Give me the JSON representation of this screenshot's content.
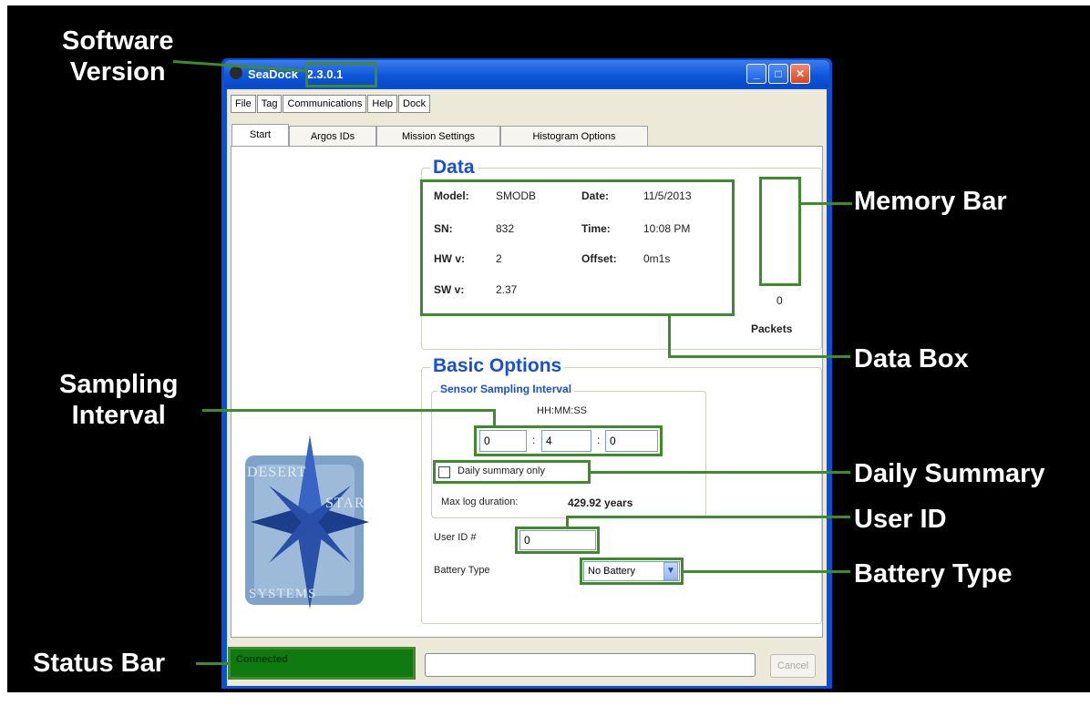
{
  "callouts": {
    "software_version_line1": "Software",
    "software_version_line2": "Version",
    "memory_bar": "Memory Bar",
    "data_box": "Data Box",
    "sampling_line1": "Sampling",
    "sampling_line2": "Interval",
    "daily_summary": "Daily Summary",
    "user_id": "User ID",
    "battery_type": "Battery Type",
    "status_bar": "Status Bar"
  },
  "window": {
    "app_name": "SeaDock",
    "version": "2.3.0.1"
  },
  "menu": [
    "File",
    "Tag",
    "Communications",
    "Help",
    "Dock"
  ],
  "tabs": [
    "Start",
    "Argos IDs",
    "Mission Settings",
    "Histogram Options"
  ],
  "data_group": {
    "title": "Data",
    "model_label": "Model:",
    "model_value": "SMODB",
    "date_label": "Date:",
    "date_value": "11/5/2013",
    "sn_label": "SN:",
    "sn_value": "832",
    "time_label": "Time:",
    "time_value": "10:08 PM",
    "hw_label": "HW v:",
    "hw_value": "2",
    "offset_label": "Offset:",
    "offset_value": "0m1s",
    "sw_label": "SW v:",
    "sw_value": "2.37",
    "packets_count": "0",
    "packets_label": "Packets"
  },
  "basic_options": {
    "title": "Basic Options",
    "sensor_title": "Sensor Sampling Interval",
    "format_label": "HH:MM:SS",
    "hh": "0",
    "mm": "4",
    "ss": "0",
    "colon": ":",
    "daily_summary_label": "Daily summary only",
    "max_log_label": "Max log duration:",
    "max_log_value": "429.92 years",
    "user_id_label": "User ID #",
    "user_id_value": "0",
    "battery_label": "Battery Type",
    "battery_value": "No Battery"
  },
  "logo": {
    "word1": "DESERT",
    "word2": "STAR",
    "word3": "SYSTEMS"
  },
  "status": {
    "text": "Connected",
    "cancel": "Cancel"
  },
  "colors": {
    "callout_green": "#3f8a2c",
    "status_green": "#0f7a0f",
    "title_blue": "#1a4fcf",
    "xp_blue": "#0a50d6"
  }
}
